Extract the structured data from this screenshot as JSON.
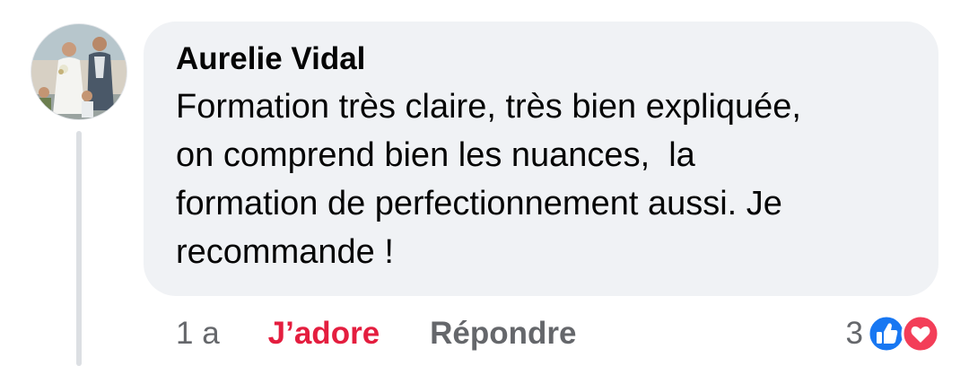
{
  "comment": {
    "author": "Aurelie Vidal",
    "text": "Formation très claire, très bien expliquée,\non comprend bien les nuances,  la\nformation de perfectionnement aussi. Je\nrecommande !",
    "time": "1 a",
    "love_label": "J’adore",
    "reply_label": "Répondre",
    "reaction_count": "3",
    "reaction_icons": [
      "like-icon",
      "love-icon"
    ]
  },
  "colors": {
    "bubble": "#f0f2f5",
    "love": "#e41e3f",
    "like": "#1877f2",
    "muted": "#65676b"
  }
}
